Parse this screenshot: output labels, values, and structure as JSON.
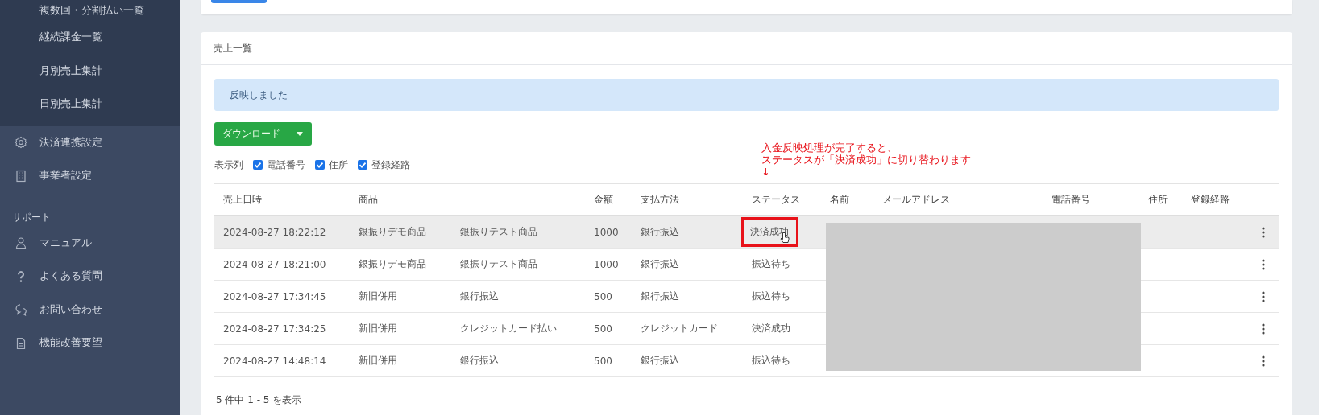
{
  "sidebar": {
    "sub_items": [
      {
        "label": "複数回・分割払い一覧"
      },
      {
        "label": "継続課金一覧"
      },
      {
        "label": "月別売上集計"
      },
      {
        "label": "日別売上集計"
      }
    ],
    "items": [
      {
        "label": "決済連携設定",
        "kind": "gear"
      },
      {
        "label": "事業者設定",
        "kind": "building"
      }
    ],
    "section": "サポート",
    "support_items": [
      {
        "label": "マニュアル",
        "kind": "person"
      },
      {
        "label": "よくある質問",
        "kind": "question"
      },
      {
        "label": "お問い合わせ",
        "kind": "chat"
      },
      {
        "label": "機能改善要望",
        "kind": "document"
      }
    ]
  },
  "card": {
    "title": "売上一覧",
    "alert": "反映しました",
    "download_button": "ダウンロード",
    "columns_label": "表示列",
    "column_toggles": [
      {
        "label": "電話番号",
        "checked": true
      },
      {
        "label": "住所",
        "checked": true
      },
      {
        "label": "登録経路",
        "checked": true
      }
    ],
    "annotation": {
      "lines": [
        "入金反映処理が完了すると、",
        "ステータスが「決済成功」に切り替わります"
      ],
      "arrow": "↓"
    },
    "table": {
      "columns": [
        "売上日時",
        "商品",
        "金額",
        "支払方法",
        "ステータス",
        "名前",
        "メールアドレス",
        "電話番号",
        "住所",
        "登録経路"
      ],
      "rows": [
        {
          "date": "2024-08-27 18:22:12",
          "product": "銀振りデモ商品",
          "item": "銀振りテスト商品",
          "amount": "1000",
          "payment": "銀行振込",
          "status": "決済成功",
          "highlighted": true,
          "annotated": true
        },
        {
          "date": "2024-08-27 18:21:00",
          "product": "銀振りデモ商品",
          "item": "銀振りテスト商品",
          "amount": "1000",
          "payment": "銀行振込",
          "status": "振込待ち",
          "highlighted": false,
          "annotated": false
        },
        {
          "date": "2024-08-27 17:34:45",
          "product": "新旧併用",
          "item": "銀行振込",
          "amount": "500",
          "payment": "銀行振込",
          "status": "振込待ち",
          "highlighted": false,
          "annotated": false
        },
        {
          "date": "2024-08-27 17:34:25",
          "product": "新旧併用",
          "item": "クレジットカード払い",
          "amount": "500",
          "payment": "クレジットカード",
          "status": "決済成功",
          "highlighted": false,
          "annotated": false
        },
        {
          "date": "2024-08-27 14:48:14",
          "product": "新旧併用",
          "item": "銀行振込",
          "amount": "500",
          "payment": "銀行振込",
          "status": "振込待ち",
          "highlighted": false,
          "annotated": false
        }
      ]
    },
    "footer": "5 件中 1 - 5 を表示"
  }
}
